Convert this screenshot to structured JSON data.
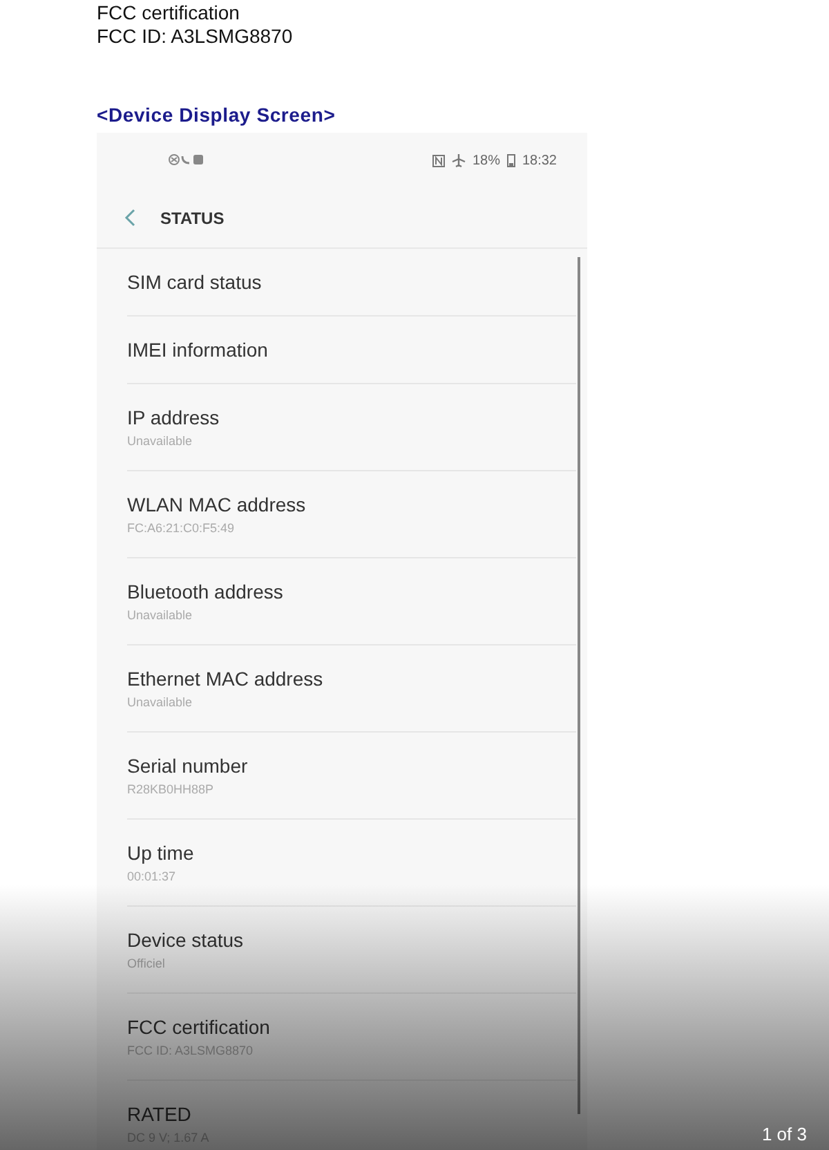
{
  "document": {
    "lines": [
      "FCC certification",
      "FCC ID: A3LSMG8870"
    ],
    "heading": "<Device Display Screen>"
  },
  "phone": {
    "status_bar": {
      "battery": "18%",
      "time": "18:32"
    },
    "title": "STATUS",
    "items": [
      {
        "title": "SIM card status"
      },
      {
        "title": "IMEI information"
      },
      {
        "title": "IP address",
        "value": "Unavailable"
      },
      {
        "title": "WLAN MAC address",
        "value": "FC:A6:21:C0:F5:49"
      },
      {
        "title": "Bluetooth address",
        "value": "Unavailable"
      },
      {
        "title": "Ethernet MAC address",
        "value": "Unavailable"
      },
      {
        "title": "Serial number",
        "value": "R28KB0HH88P"
      },
      {
        "title": "Up time",
        "value": "00:01:37"
      },
      {
        "title": "Device status",
        "value": "Officiel"
      },
      {
        "title": "FCC certification",
        "value": "FCC ID: A3LSMG8870"
      },
      {
        "title": "RATED",
        "value": "DC 9 V; 1.67 A"
      }
    ]
  },
  "viewer": {
    "page_counter": "1 of 3"
  }
}
